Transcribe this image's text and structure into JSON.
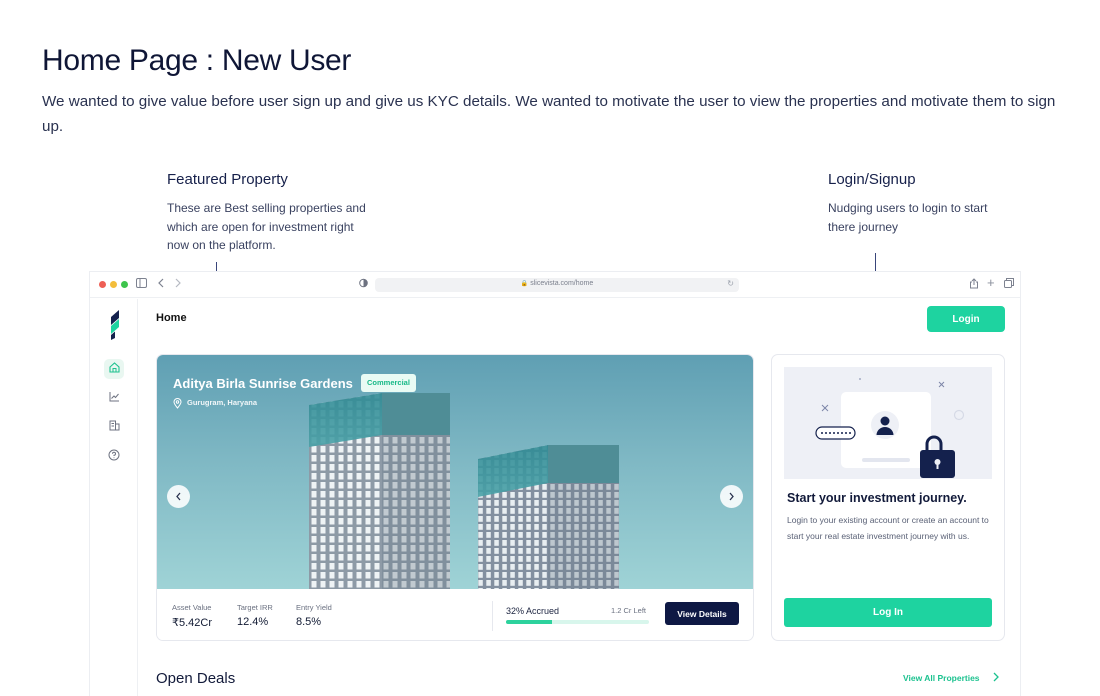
{
  "header": {
    "title": "Home Page : New User",
    "description": "We wanted to give value before user sign up and give us KYC details. We wanted to motivate the user to view the properties and motivate them to sign up."
  },
  "annotations": {
    "featured": {
      "title": "Featured Property",
      "text": "These are Best selling properties and which are open for investment right now on the platform."
    },
    "login": {
      "title": "Login/Signup",
      "text": "Nudging users to login to start there journey"
    }
  },
  "browser": {
    "url": "slicevista.com/home"
  },
  "app": {
    "page_label": "Home",
    "login_button": "Login",
    "sidebar_icons": [
      "home-icon",
      "chart-icon",
      "building-icon",
      "help-icon"
    ],
    "featured": {
      "name": "Aditya Birla Sunrise Gardens",
      "tag": "Commercial",
      "location": "Gurugram, Haryana",
      "stats": [
        {
          "label": "Asset Value",
          "value": "₹5.42Cr"
        },
        {
          "label": "Target IRR",
          "value": "12.4%"
        },
        {
          "label": "Entry Yield",
          "value": "8.5%"
        }
      ],
      "accrued_text": "32% Accrued",
      "accrued_percent": 32,
      "left_text": "1.2 Cr Left",
      "view_details": "View Details"
    },
    "login_card": {
      "title": "Start your investment journey.",
      "text": "Login to your existing account or create an account to start your real estate investment journey with us.",
      "button": "Log In"
    },
    "open_deals": {
      "title": "Open Deals",
      "view_all": "View All Properties"
    }
  },
  "colors": {
    "accent": "#1ed3a0",
    "navy": "#0e1844",
    "text": "#121a3a"
  }
}
